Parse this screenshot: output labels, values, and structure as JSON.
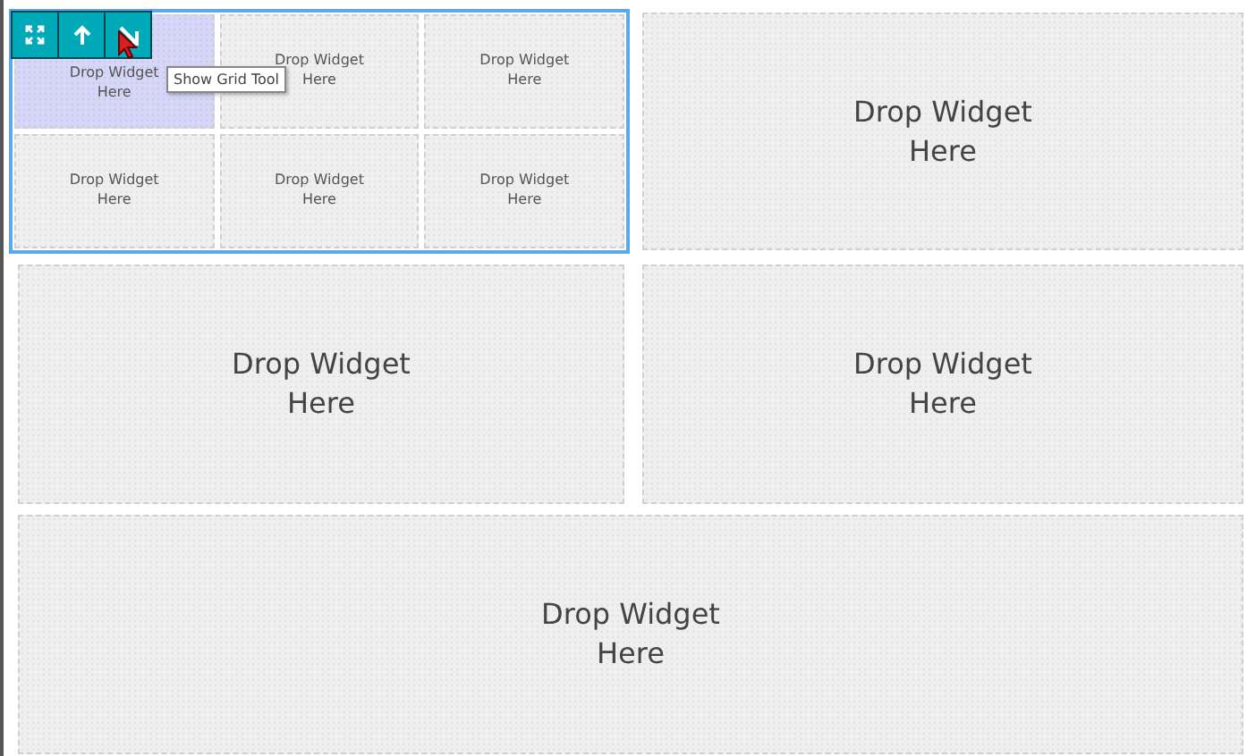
{
  "grid_tool": {
    "buttons": [
      {
        "kind": "expand"
      },
      {
        "kind": "up"
      },
      {
        "kind": "down-right"
      }
    ],
    "tooltip": "Show Grid Tool"
  },
  "nested_grid": {
    "cells": [
      {
        "label": "Drop Widget\nHere",
        "selected": true
      },
      {
        "label": "Drop Widget\nHere",
        "selected": false
      },
      {
        "label": "Drop Widget\nHere",
        "selected": false
      },
      {
        "label": "Drop Widget\nHere",
        "selected": false
      },
      {
        "label": "Drop Widget\nHere",
        "selected": false
      },
      {
        "label": "Drop Widget\nHere",
        "selected": false
      }
    ]
  },
  "zones": [
    {
      "label": "Drop Widget\nHere"
    },
    {
      "label": "Drop Widget\nHere"
    },
    {
      "label": "Drop Widget\nHere"
    },
    {
      "label": "Drop Widget\nHere"
    }
  ]
}
